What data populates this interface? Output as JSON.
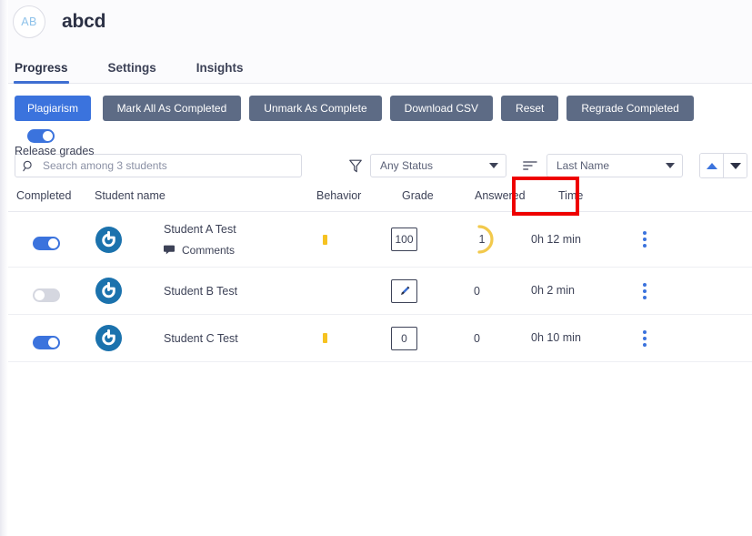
{
  "header": {
    "avatar_initials": "AB",
    "course_title": "abcd"
  },
  "tabs": [
    {
      "label": "Progress",
      "active": true
    },
    {
      "label": "Settings",
      "active": false
    },
    {
      "label": "Insights",
      "active": false
    }
  ],
  "toolbar": {
    "plagiarism_label": "Plagiarism",
    "release_grades_label": "Release grades",
    "release_grades_on": true,
    "mark_all_label": "Mark All As Completed",
    "unmark_label": "Unmark As Complete",
    "download_csv_label": "Download CSV",
    "reset_label": "Reset",
    "regrade_label": "Regrade Completed",
    "highlight_color": "#ee0000",
    "primary_color": "#3b73dd",
    "secondary_color": "#5d6b85"
  },
  "filters": {
    "search_placeholder": "Search among 3 students",
    "search_value": "",
    "status_select": "Any Status",
    "sort_select": "Last Name",
    "sort_asc_active": true
  },
  "table": {
    "columns": [
      "Completed",
      "Student name",
      "Behavior",
      "Grade",
      "Answered",
      "Time"
    ],
    "rows": [
      {
        "completed": true,
        "name": "Student A Test",
        "comments_label": "Comments",
        "has_comments": true,
        "behavior_flag": true,
        "grade": "100",
        "grade_is_icon": false,
        "answered": "1",
        "answered_has_ring": true,
        "time": "0h 12 min"
      },
      {
        "completed": false,
        "name": "Student B Test",
        "comments_label": "",
        "has_comments": false,
        "behavior_flag": false,
        "grade": "",
        "grade_is_icon": true,
        "answered": "0",
        "answered_has_ring": false,
        "time": "0h 2 min"
      },
      {
        "completed": true,
        "name": "Student C Test",
        "comments_label": "",
        "has_comments": false,
        "behavior_flag": true,
        "grade": "0",
        "grade_is_icon": false,
        "answered": "0",
        "answered_has_ring": false,
        "time": "0h 10 min"
      }
    ]
  },
  "colors": {
    "accent_blue": "#3b73dd",
    "gravatar_blue": "#1b72ad",
    "behavior_yellow": "#f6c221",
    "ring_yellow": "#f2c94c",
    "toggle_off": "#d5d7e0"
  }
}
